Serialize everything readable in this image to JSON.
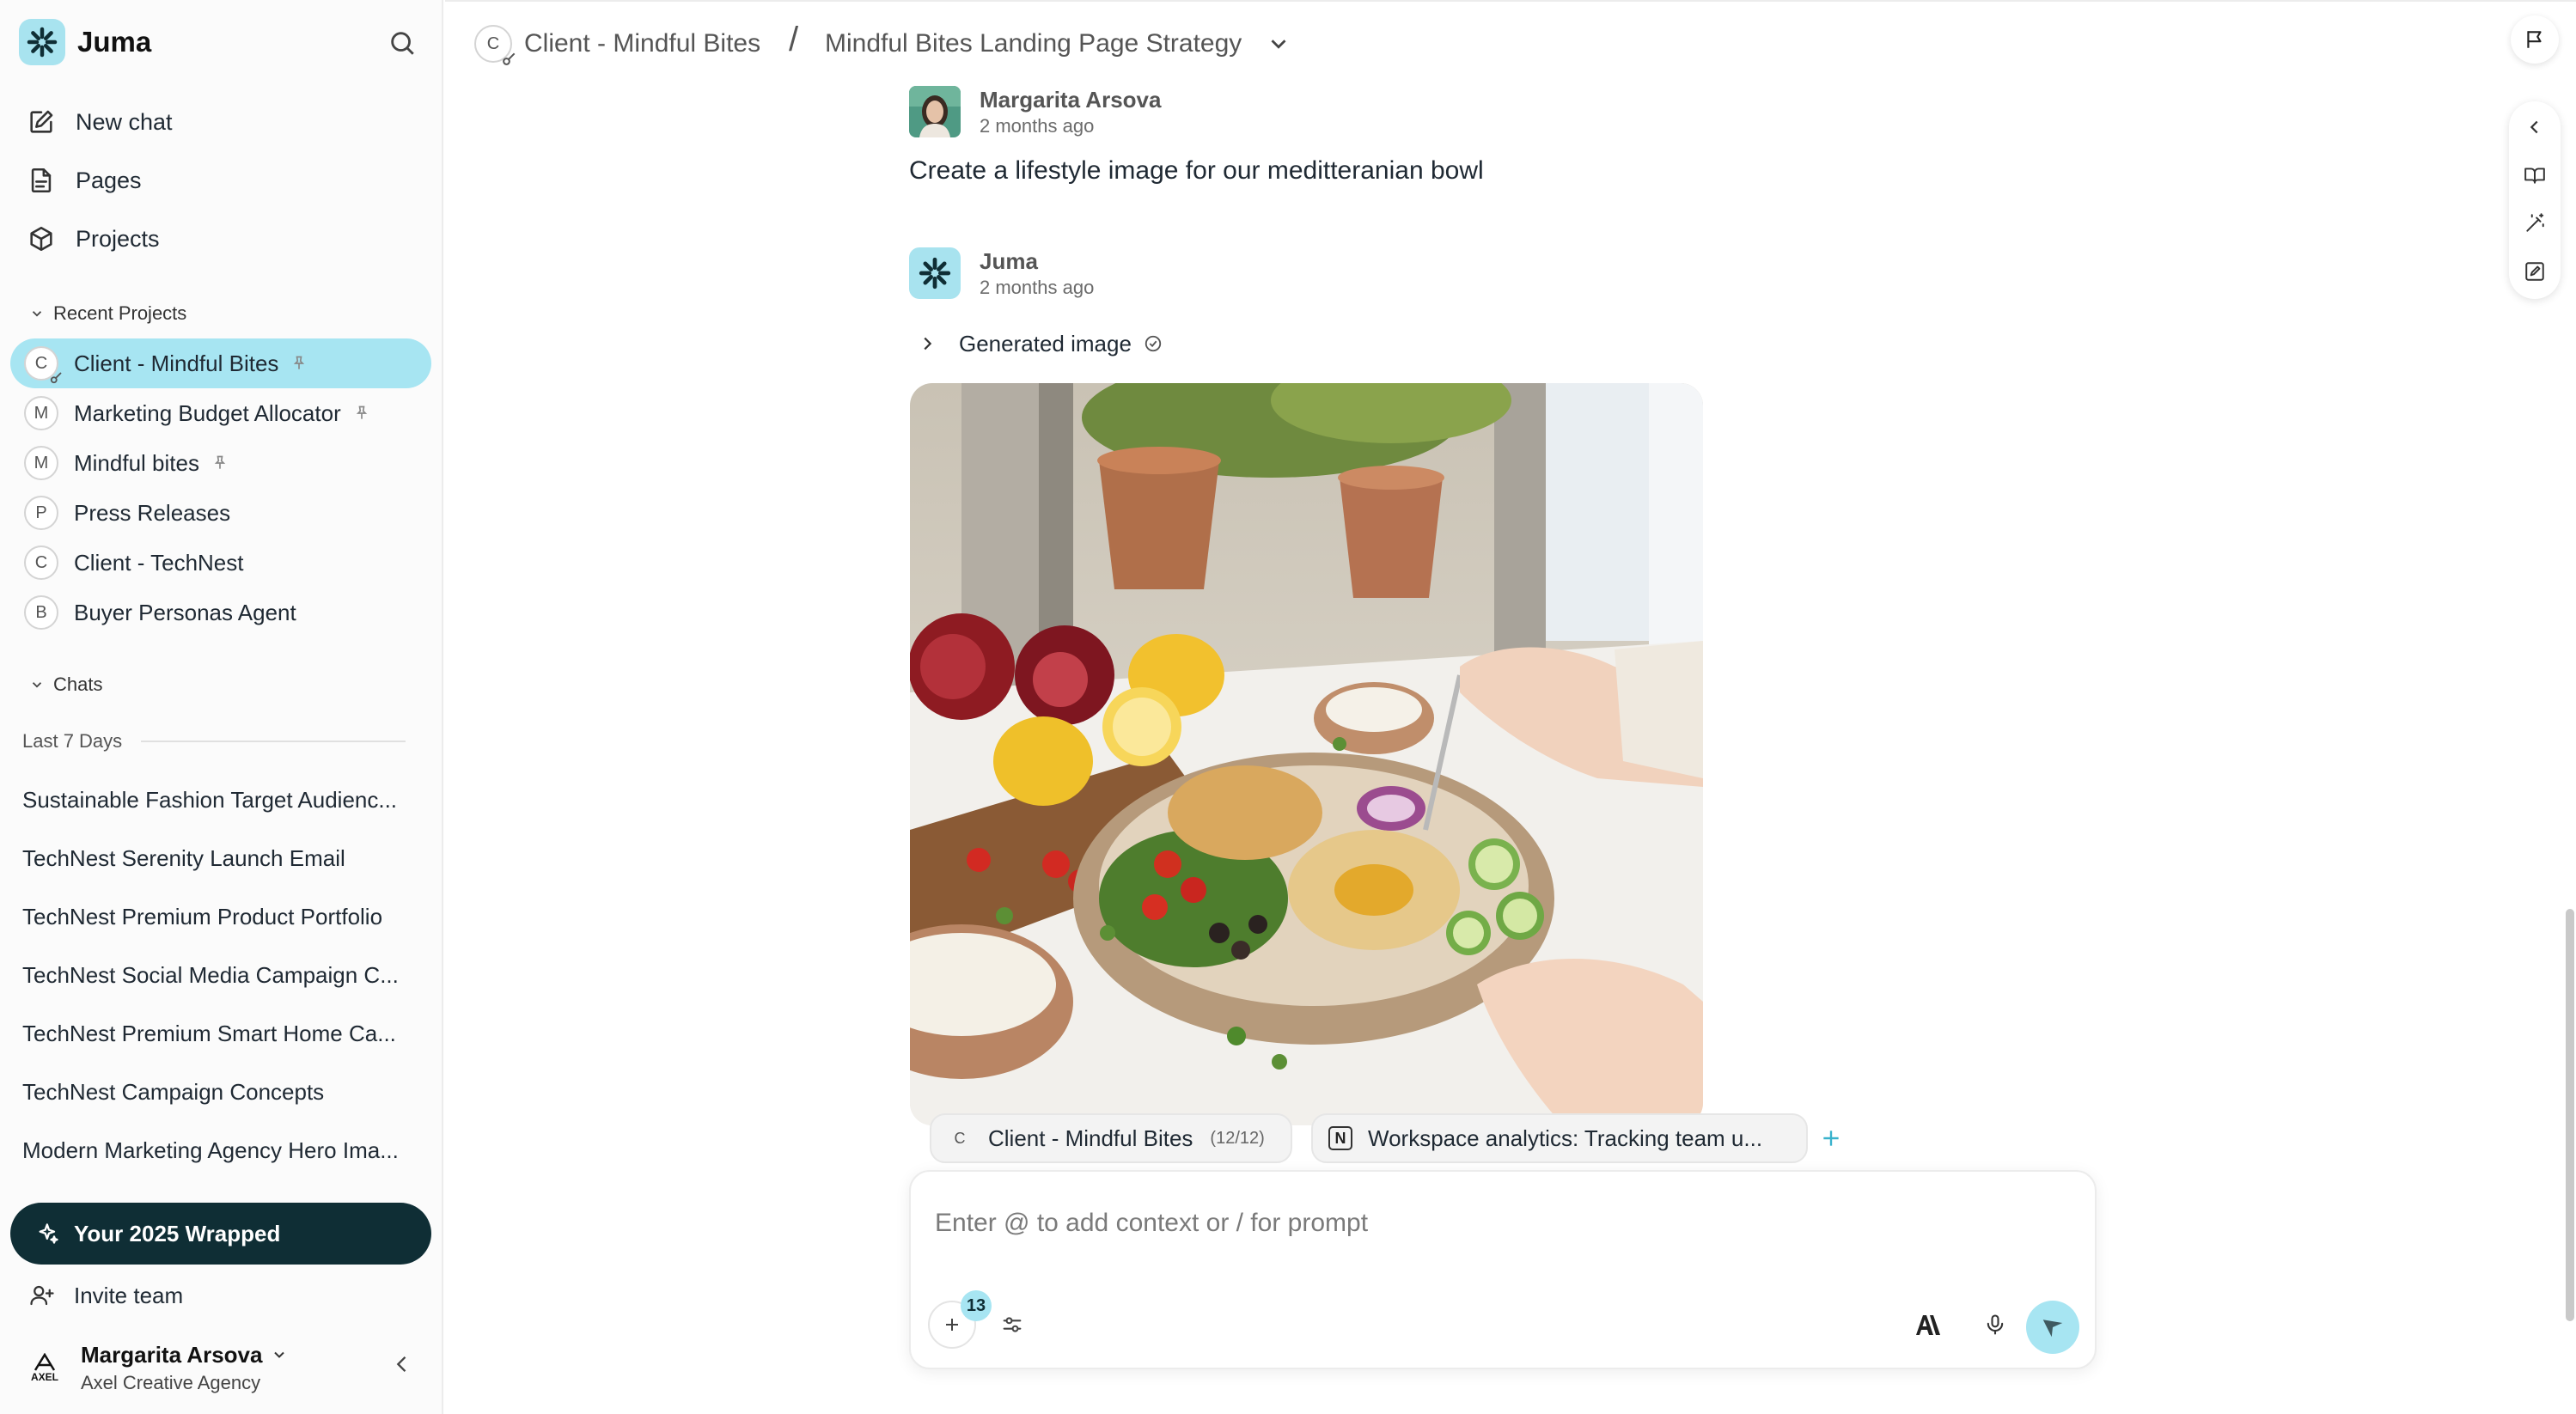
{
  "app": {
    "name": "Juma"
  },
  "sidebar": {
    "nav": [
      {
        "label": "New chat",
        "icon": "edit-icon"
      },
      {
        "label": "Pages",
        "icon": "document-icon"
      },
      {
        "label": "Projects",
        "icon": "cube-icon"
      }
    ],
    "recent_projects_title": "Recent Projects",
    "projects": [
      {
        "letter": "C",
        "label": "Client - Mindful Bites",
        "pinned": true,
        "active": true
      },
      {
        "letter": "M",
        "label": "Marketing Budget Allocator",
        "pinned": true,
        "active": false
      },
      {
        "letter": "M",
        "label": "Mindful bites",
        "pinned": true,
        "active": false
      },
      {
        "letter": "P",
        "label": "Press Releases",
        "pinned": false,
        "active": false
      },
      {
        "letter": "C",
        "label": "Client - TechNest",
        "pinned": false,
        "active": false
      },
      {
        "letter": "B",
        "label": "Buyer Personas Agent",
        "pinned": false,
        "active": false
      }
    ],
    "chats_title": "Chats",
    "chats_group": "Last 7 Days",
    "chats": [
      "Sustainable Fashion Target Audienc...",
      "TechNest Serenity Launch Email",
      "TechNest Premium Product Portfolio",
      "TechNest Social Media Campaign C...",
      "TechNest Premium Smart Home Ca...",
      "TechNest Campaign Concepts",
      "Modern Marketing Agency Hero Ima..."
    ],
    "wrapped_label": "Your 2025 Wrapped",
    "invite_label": "Invite team",
    "user": {
      "name": "Margarita Arsova",
      "org": "Axel Creative Agency",
      "avatar_text": "AXEL"
    }
  },
  "header": {
    "project_letter": "C",
    "project": "Client - Mindful Bites",
    "separator": "/",
    "chat_title": "Mindful Bites Landing Page Strategy"
  },
  "messages": [
    {
      "author": "Margarita Arsova",
      "time": "2 months ago",
      "text": "Create a lifestyle image for our meditteranian bowl"
    },
    {
      "author": "Juma",
      "time": "2 months ago",
      "tool_label": "Generated image"
    }
  ],
  "context_chips": [
    {
      "letter": "C",
      "label": "Client - Mindful Bites",
      "count": "(12/12)"
    },
    {
      "icon": "notion-icon",
      "icon_text": "N",
      "label": "Workspace analytics: Tracking team u..."
    }
  ],
  "composer": {
    "placeholder": "Enter @ to add context or / for prompt",
    "badge_count": "13"
  },
  "colors": {
    "accent": "#a7e5f2",
    "dark": "#0f2e35"
  }
}
